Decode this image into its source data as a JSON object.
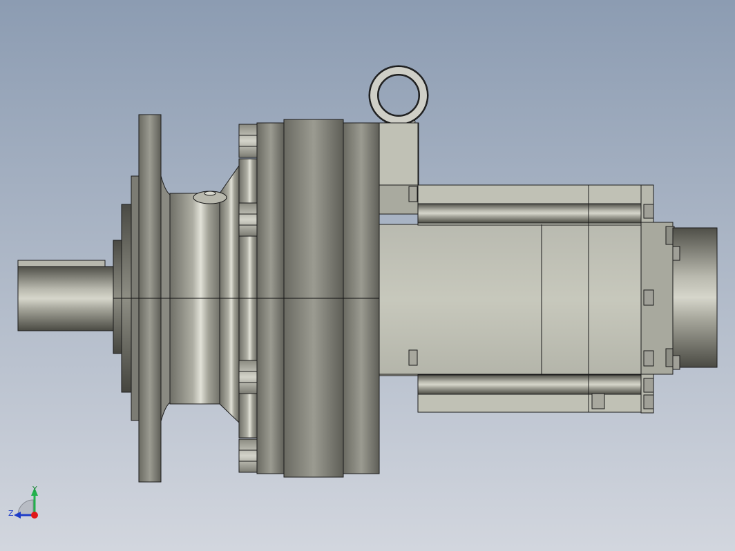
{
  "viewport": {
    "background_top": "#8c9cb2",
    "background_bottom": "#d2d6de",
    "model_name": "servo-motor-with-planetary-gearbox",
    "render_style": "shaded-with-edges"
  },
  "triad": {
    "y_label": "Y",
    "z_label": "Z",
    "y_color": "#22b14c",
    "z_color": "#1e3cc8",
    "x_color": "#e01818"
  },
  "colors": {
    "metal_dark": "#5f5f57",
    "metal_mid": "#9a9a90",
    "metal_light": "#c8c8be",
    "motor_body": "#c3c4b8",
    "edge": "#1a1a1a"
  }
}
